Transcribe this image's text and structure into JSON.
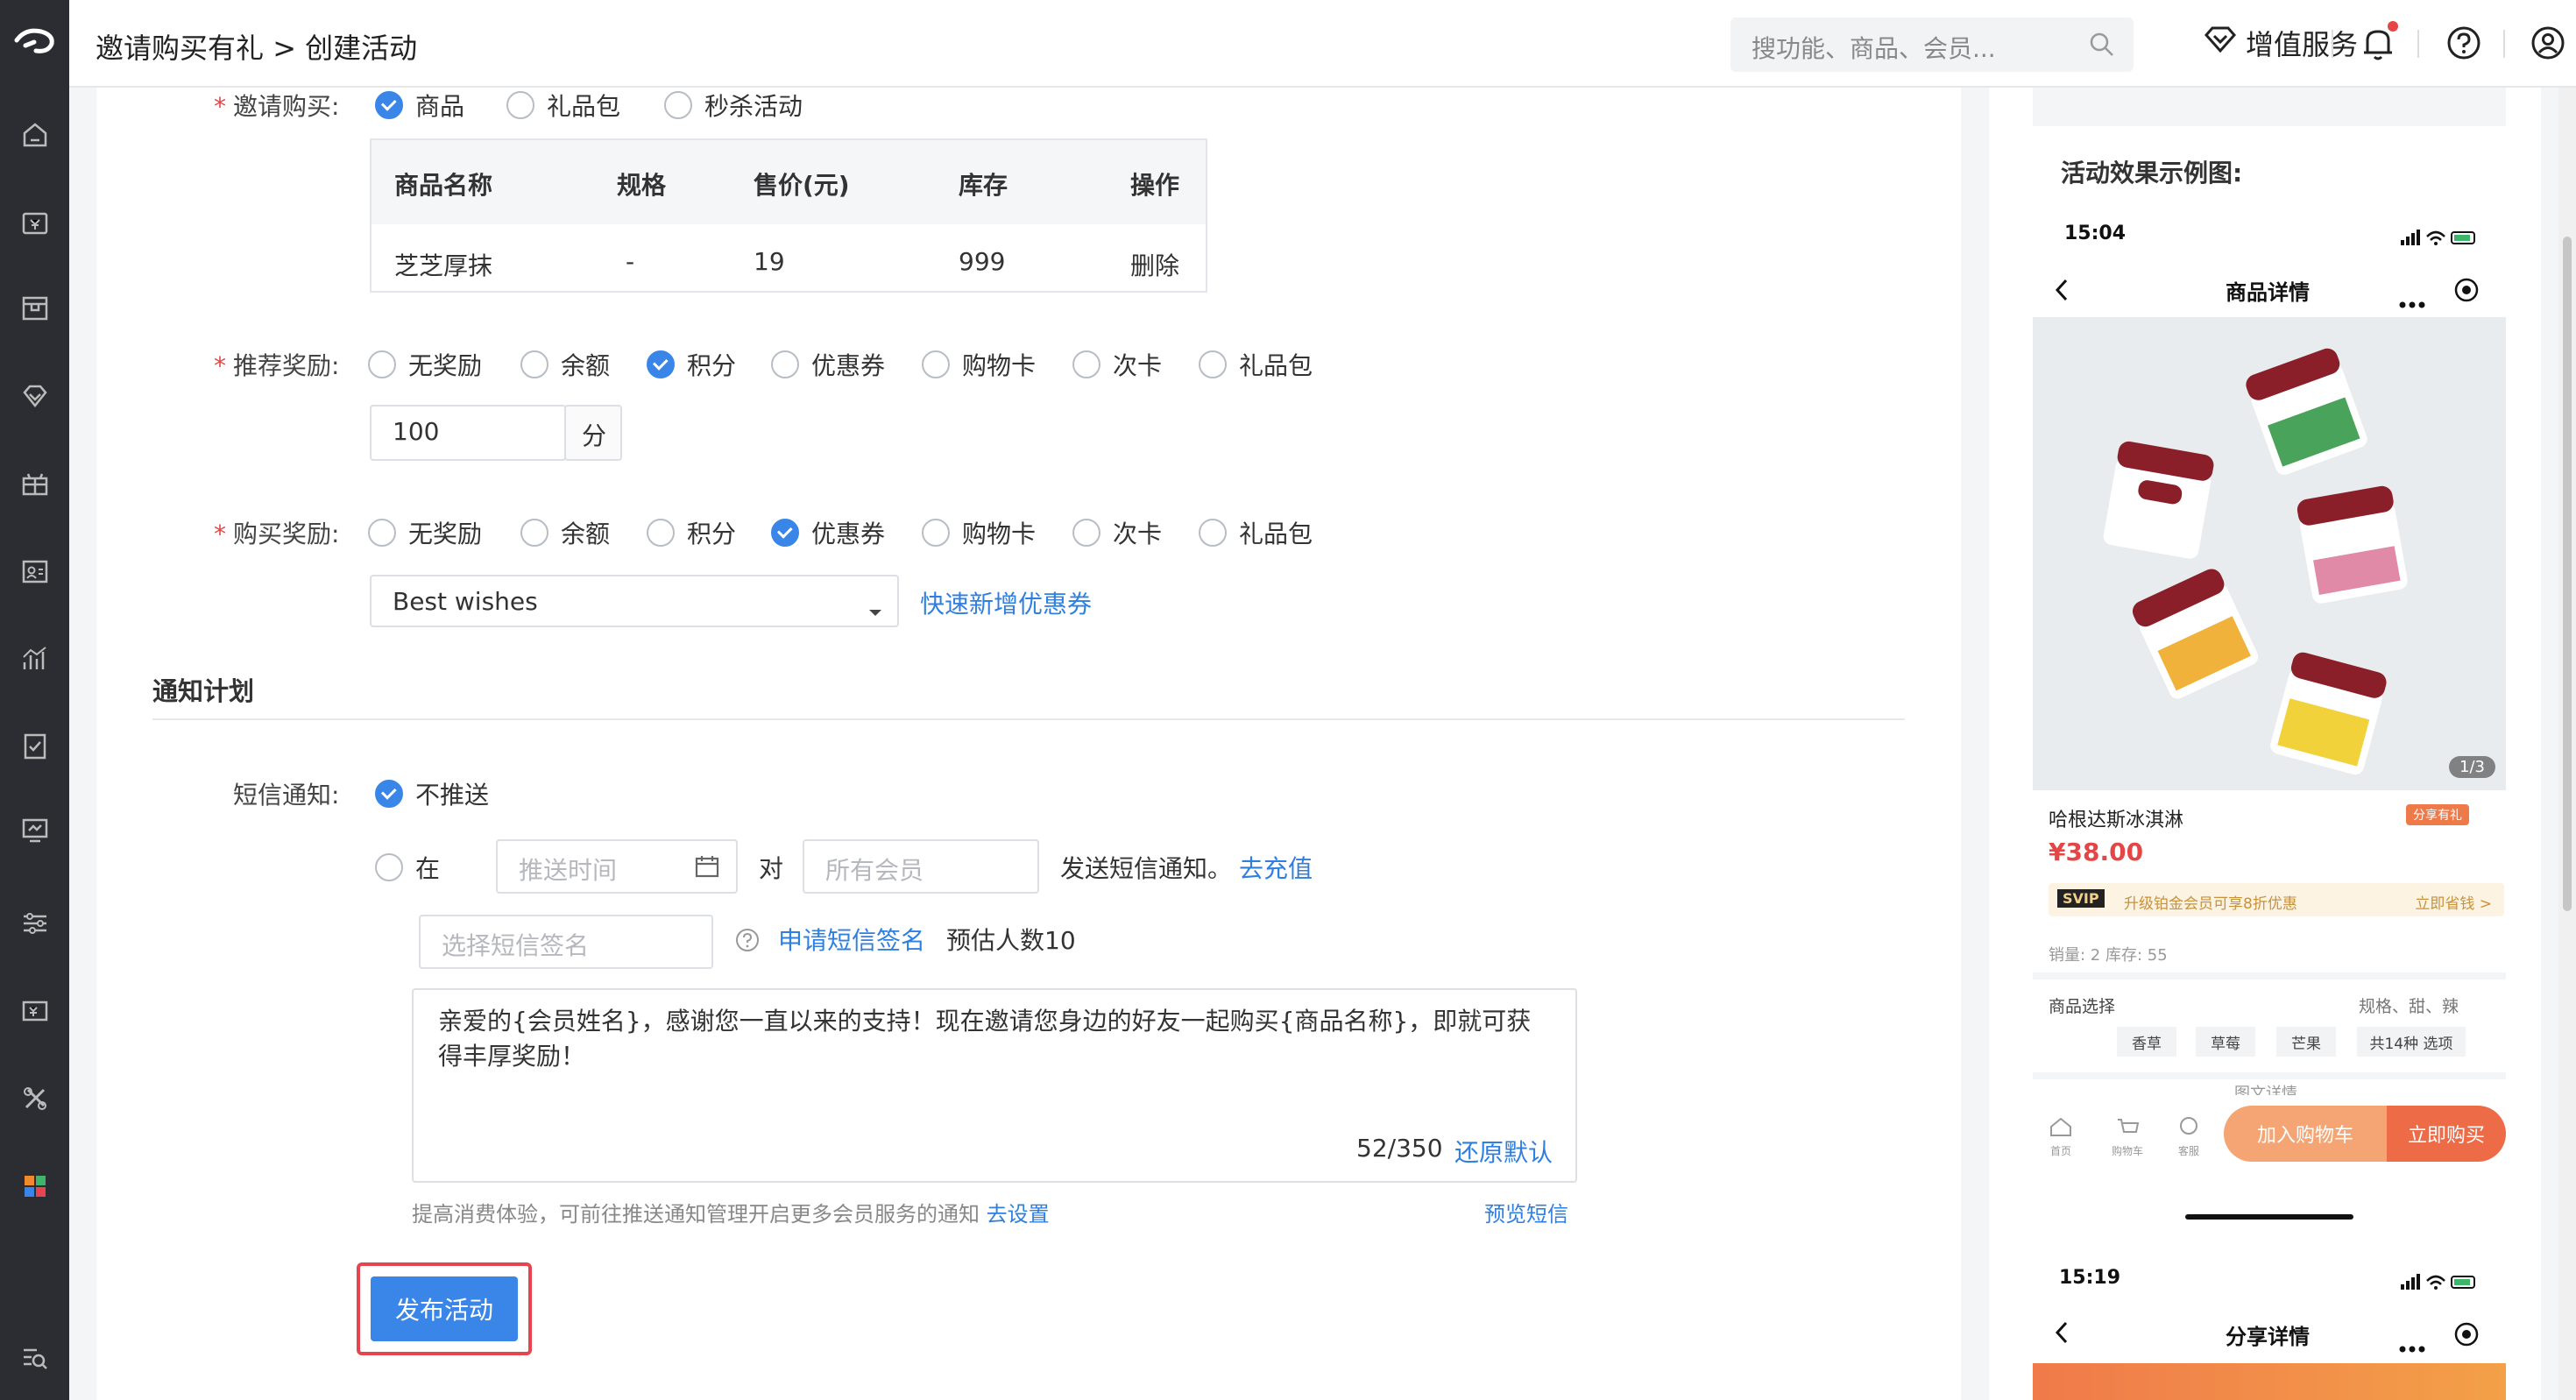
{
  "header": {
    "breadcrumb_parent": "邀请购买有礼",
    "breadcrumb_sep": ">",
    "breadcrumb_current": "创建活动",
    "search_placeholder": "搜功能、商品、会员...",
    "value_added": "增值服务"
  },
  "form": {
    "invite_buy": {
      "label": "邀请购买:",
      "options": [
        "商品",
        "礼品包",
        "秒杀活动"
      ],
      "selected": "商品"
    },
    "product_table": {
      "headers": [
        "商品名称",
        "规格",
        "售价(元)",
        "库存",
        "操作"
      ],
      "rows": [
        [
          "芝芝厚抹",
          "-",
          "19",
          "999",
          "删除"
        ]
      ]
    },
    "referral_reward": {
      "label": "推荐奖励:",
      "options": [
        "无奖励",
        "余额",
        "积分",
        "优惠券",
        "购物卡",
        "次卡",
        "礼品包"
      ],
      "selected": "积分",
      "points_value": "100",
      "points_unit": "分"
    },
    "purchase_reward": {
      "label": "购买奖励:",
      "options": [
        "无奖励",
        "余额",
        "积分",
        "优惠券",
        "购物卡",
        "次卡",
        "礼品包"
      ],
      "selected": "优惠券",
      "coupon_value": "Best wishes",
      "add_coupon_link": "快速新增优惠券"
    },
    "notify_section_title": "通知计划",
    "sms": {
      "label": "短信通知:",
      "no_push": "不推送",
      "at": "在",
      "time_placeholder": "推送时间",
      "to": "对",
      "member_placeholder": "所有会员",
      "send_text": "发送短信通知。",
      "recharge_link": "去充值",
      "signature_placeholder": "选择短信签名",
      "apply_signature_link": "申请短信签名",
      "estimated": "预估人数10",
      "message_line1": "亲爱的{会员姓名}，感谢您一直以来的支持！现在邀请您身边的好友一起购买{商品名称}，即就可获",
      "message_line2": "得丰厚奖励！",
      "char_count": "52/350",
      "restore_link": "还原默认",
      "hint": "提高消费体验，可前往推送通知管理开启更多会员服务的通知",
      "hint_link": "去设置",
      "preview_link": "预览短信"
    },
    "publish_button": "发布活动"
  },
  "preview": {
    "title": "活动效果示例图:",
    "phone1": {
      "time": "15:04",
      "nav_title": "商品详情",
      "image_counter": "1/3",
      "product_name": "哈根达斯冰淇淋",
      "share_badge": "分享有礼",
      "price": "¥38.00",
      "vip_tag": "SVIP",
      "vip_text": "升级铂金会员可享8折优惠",
      "vip_link": "立即省钱 >",
      "sales": "销量: 2 库存: 55",
      "spec_label": "商品选择",
      "spec_value": "规格、甜、辣",
      "spec_options": [
        "香草",
        "草莓",
        "芒果",
        "共14种 选项"
      ],
      "detail_label": "图文详情",
      "tab_home": "首页",
      "tab_cart": "购物车",
      "tab_service": "客服",
      "add_cart": "加入购物车",
      "buy_now": "立即购买"
    },
    "phone2": {
      "time": "15:19",
      "nav_title": "分享详情"
    }
  },
  "colors": {
    "primary": "#3a86e8",
    "sidebar": "#2b2d32",
    "required": "#e54545",
    "accent_orange": "#ee7a4a"
  }
}
